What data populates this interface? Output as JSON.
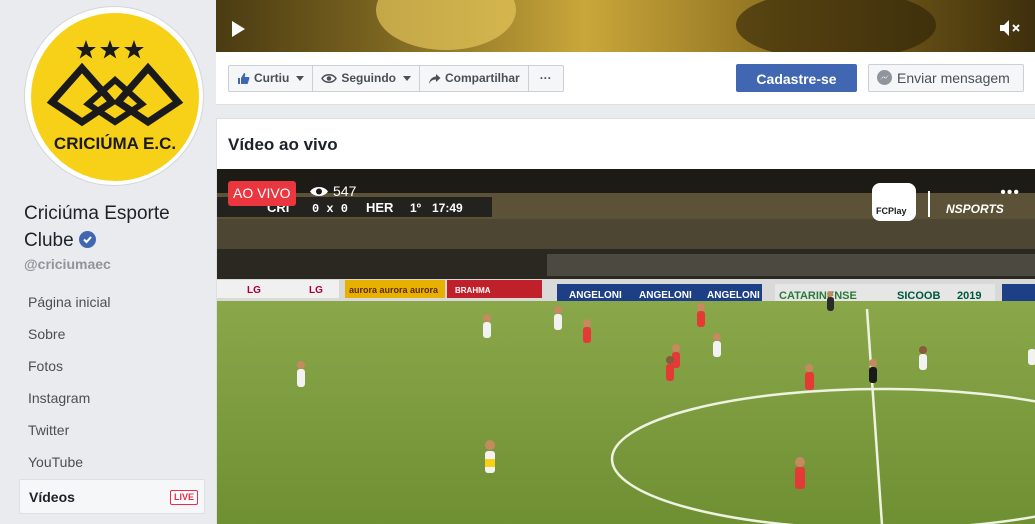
{
  "page": {
    "name": "Criciúma Esporte Clube",
    "handle": "@criciumaec",
    "logo_text": "CRICIÚMA E.C."
  },
  "sidebar": {
    "items": [
      {
        "label": "Página inicial"
      },
      {
        "label": "Sobre"
      },
      {
        "label": "Fotos"
      },
      {
        "label": "Instagram"
      },
      {
        "label": "Twitter"
      },
      {
        "label": "YouTube"
      },
      {
        "label": "Vídeos",
        "badge": "LIVE",
        "active": true
      }
    ]
  },
  "actions": {
    "like": "Curtiu",
    "following": "Seguindo",
    "share": "Compartilhar",
    "more": "···",
    "signup": "Cadastre-se",
    "message": "Enviar mensagem"
  },
  "live_section": {
    "title": "Vídeo ao vivo",
    "live_label": "AO VIVO",
    "viewers": "547",
    "scoreboard": {
      "home": "CRI",
      "score": "0 x 0",
      "away": "HER",
      "period": "1º",
      "clock": "17:49"
    },
    "broadcaster_logos": [
      "FCPlay",
      "NSPORTS"
    ],
    "ad_boards": [
      "LG",
      "LG",
      "aurora aurora aurora",
      "BRAHMA",
      "ANGELONI",
      "ANGELONI",
      "ANGELONI",
      "CATARINENSE",
      "SICOOB",
      "2019"
    ]
  },
  "colors": {
    "facebook_blue": "#4267b2",
    "live_red": "#e9363f",
    "club_yellow": "#f7d117"
  }
}
